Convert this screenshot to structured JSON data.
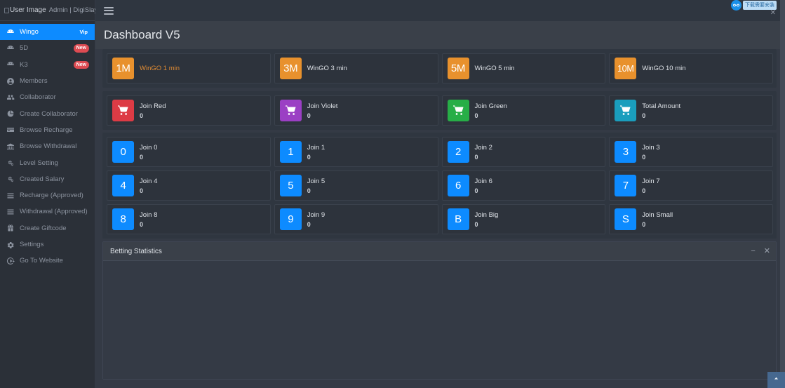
{
  "header": {
    "user_image_alt": "User Image",
    "user_name": "Admin | DigiSlay",
    "menu_icon": "hamburger-icon"
  },
  "sidebar": {
    "items": [
      {
        "label": "Wingo",
        "icon": "dice-icon",
        "badge": "Vip",
        "badge_type": "vip",
        "active": true
      },
      {
        "label": "5D",
        "icon": "dice-icon",
        "badge": "New",
        "badge_type": "new",
        "active": false
      },
      {
        "label": "K3",
        "icon": "dice-icon",
        "badge": "New",
        "badge_type": "new",
        "active": false
      },
      {
        "label": "Members",
        "icon": "user-circle-icon",
        "badge": "",
        "badge_type": "",
        "active": false
      },
      {
        "label": "Collaborator",
        "icon": "users-icon",
        "badge": "",
        "badge_type": "",
        "active": false
      },
      {
        "label": "Create Collaborator",
        "icon": "pie-chart-icon",
        "badge": "",
        "badge_type": "",
        "active": false
      },
      {
        "label": "Browse Recharge",
        "icon": "credit-card-icon",
        "badge": "",
        "badge_type": "",
        "active": false
      },
      {
        "label": "Browse Withdrawal",
        "icon": "bank-icon",
        "badge": "",
        "badge_type": "",
        "active": false
      },
      {
        "label": "Level Setting",
        "icon": "gears-icon",
        "badge": "",
        "badge_type": "",
        "active": false
      },
      {
        "label": "Created Salary",
        "icon": "gears-icon",
        "badge": "",
        "badge_type": "",
        "active": false
      },
      {
        "label": "Recharge (Approved)",
        "icon": "list-icon",
        "badge": "",
        "badge_type": "",
        "active": false
      },
      {
        "label": "Withdrawal (Approved)",
        "icon": "list-icon",
        "badge": "",
        "badge_type": "",
        "active": false
      },
      {
        "label": "Create Giftcode",
        "icon": "gift-icon",
        "badge": "",
        "badge_type": "",
        "active": false
      },
      {
        "label": "Settings",
        "icon": "gear-icon",
        "badge": "",
        "badge_type": "",
        "active": false
      },
      {
        "label": "Go To Website",
        "icon": "sign-out-icon",
        "badge": "",
        "badge_type": "",
        "active": false
      }
    ]
  },
  "page": {
    "title": "Dashboard V5"
  },
  "game_modes": [
    {
      "tile": "1M",
      "label": "WinGO 1 min",
      "color": "#e8912d",
      "active": true
    },
    {
      "tile": "3M",
      "label": "WinGO 3 min",
      "color": "#e8912d",
      "active": false
    },
    {
      "tile": "5M",
      "label": "WinGO 5 min",
      "color": "#e8912d",
      "active": false
    },
    {
      "tile": "10M",
      "label": "WinGO 10 min",
      "color": "#e8912d",
      "active": false
    }
  ],
  "join_color_cards": [
    {
      "icon": "cart-icon",
      "label": "Join Red",
      "value": "0",
      "color": "#dd3b45"
    },
    {
      "icon": "cart-icon",
      "label": "Join Violet",
      "value": "0",
      "color": "#9b3fc4"
    },
    {
      "icon": "cart-icon",
      "label": "Join Green",
      "value": "0",
      "color": "#27ae47"
    },
    {
      "icon": "cart-icon",
      "label": "Total Amount",
      "value": "0",
      "color": "#1a9ebd"
    }
  ],
  "join_number_cards": [
    {
      "tile": "0",
      "label": "Join 0",
      "value": "0",
      "color": "#0d8bff"
    },
    {
      "tile": "1",
      "label": "Join 1",
      "value": "0",
      "color": "#0d8bff"
    },
    {
      "tile": "2",
      "label": "Join 2",
      "value": "0",
      "color": "#0d8bff"
    },
    {
      "tile": "3",
      "label": "Join 3",
      "value": "0",
      "color": "#0d8bff"
    },
    {
      "tile": "4",
      "label": "Join 4",
      "value": "0",
      "color": "#0d8bff"
    },
    {
      "tile": "5",
      "label": "Join 5",
      "value": "0",
      "color": "#0d8bff"
    },
    {
      "tile": "6",
      "label": "Join 6",
      "value": "0",
      "color": "#0d8bff"
    },
    {
      "tile": "7",
      "label": "Join 7",
      "value": "0",
      "color": "#0d8bff"
    },
    {
      "tile": "8",
      "label": "Join 8",
      "value": "0",
      "color": "#0d8bff"
    },
    {
      "tile": "9",
      "label": "Join 9",
      "value": "0",
      "color": "#0d8bff"
    },
    {
      "tile": "B",
      "label": "Join Big",
      "value": "0",
      "color": "#0d8bff"
    },
    {
      "tile": "S",
      "label": "Join Small",
      "value": "0",
      "color": "#0d8bff"
    }
  ],
  "betting_statistics": {
    "title": "Betting Statistics",
    "minimize_label": "−",
    "close_label": "✕"
  },
  "extension_overlay": {
    "icon": "infinity-icon",
    "pill_text": "下载需要安装",
    "close_label": "✕"
  },
  "scroll_top": {
    "icon": "chevron-up-icon"
  },
  "colors": {
    "accent_blue": "#0d8bff",
    "accent_orange": "#e8912d",
    "page_bg": "#343a45",
    "sidebar_bg": "#2b3038",
    "card_bg": "#2d333c"
  }
}
